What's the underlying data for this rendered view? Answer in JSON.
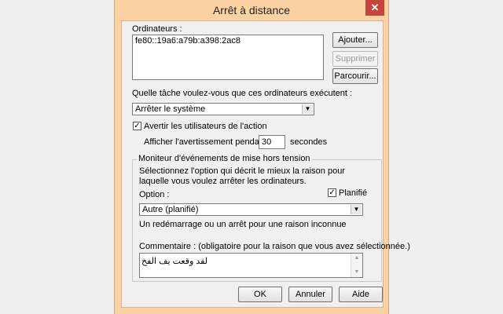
{
  "window": {
    "title": "Arrêt à distance",
    "close_glyph": "✕"
  },
  "computers": {
    "label": "Ordinateurs :",
    "items": [
      "fe80::19a6:a79b:a398:2ac8"
    ],
    "add_button": "Ajouter...",
    "remove_button": "Supprimer",
    "browse_button": "Parcourir..."
  },
  "task": {
    "label": "Quelle tâche voulez-vous que ces ordinateurs exécutent :",
    "selected": "Arrêter le système"
  },
  "warn": {
    "label": "Avertir les utilisateurs de l'action",
    "checked": true,
    "display_label": "Afficher l'avertissement pendant",
    "seconds_value": "30",
    "seconds_label": "secondes"
  },
  "tracker": {
    "legend": "Moniteur d'événements de mise hors tension",
    "description": "Sélectionnez l'option qui décrit le mieux la raison pour laquelle vous voulez arrêter les ordinateurs.",
    "option_label": "Option :",
    "planned_label": "Planifié",
    "planned_checked": true,
    "option_selected": "Autre (planifié)",
    "option_description": "Un redémarrage ou un arrêt pour une raison inconnue",
    "comment_label": "Commentaire : (obligatoire pour la raison que vous avez sélectionnée.)",
    "comment_value": "لقد وقعت يف الفخ"
  },
  "buttons": {
    "ok": "OK",
    "cancel": "Annuler",
    "help": "Aide"
  },
  "icons": {
    "dropdown": "chevron-down-icon",
    "check": "checkmark-icon"
  }
}
